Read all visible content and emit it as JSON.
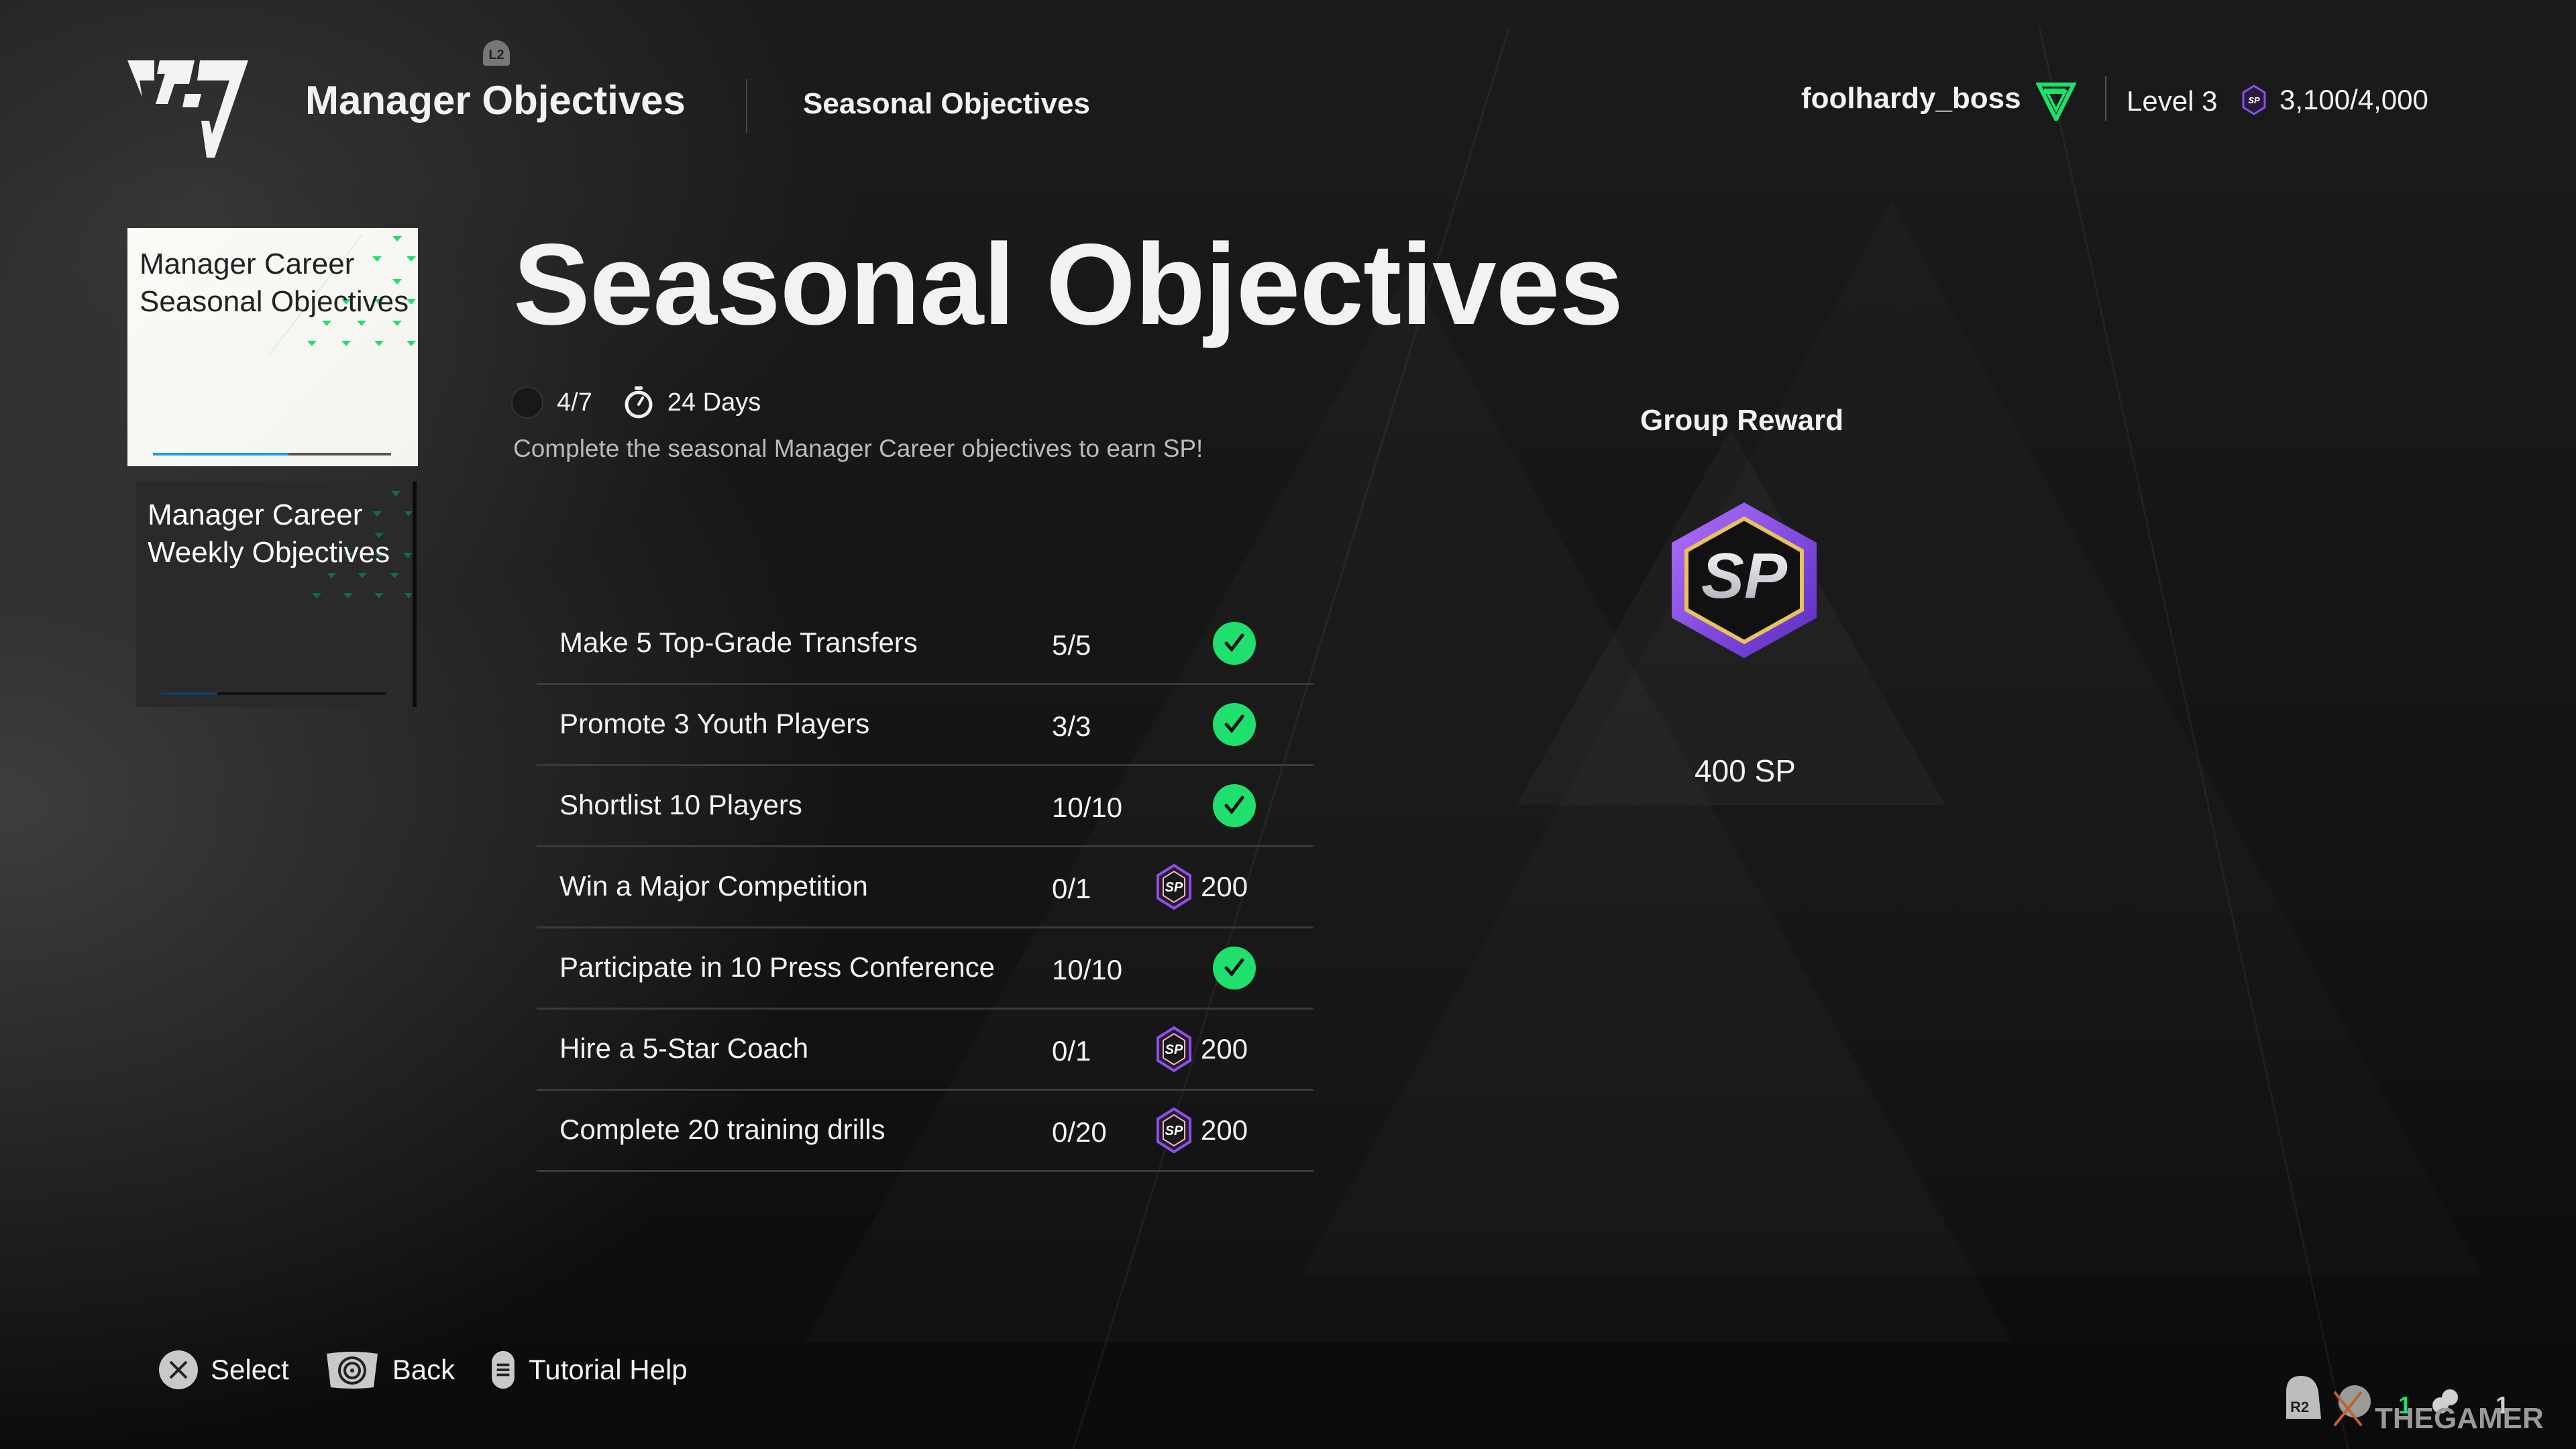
{
  "header": {
    "l2_badge": "L2",
    "title": "Manager Objectives",
    "subtitle": "Seasonal Objectives",
    "username": "foolhardy_boss",
    "level": "Level 3",
    "sp_badge": "SP",
    "sp_total": "3,100/4,000"
  },
  "cards": [
    {
      "title": "Manager Career\nSeasonal Objectives",
      "progress": 0.57,
      "selected": true
    },
    {
      "title": "Manager Career\nWeekly Objectives",
      "progress": 0.25,
      "selected": false
    }
  ],
  "main": {
    "title": "Seasonal Objectives",
    "completed": "4/7",
    "time_left": "24 Days",
    "description": "Complete the seasonal Manager Career objectives to earn SP!",
    "objectives": [
      {
        "name": "Make 5 Top-Grade Transfers",
        "progress": "5/5",
        "status": "complete",
        "reward": ""
      },
      {
        "name": "Promote 3 Youth Players",
        "progress": "3/3",
        "status": "complete",
        "reward": ""
      },
      {
        "name": "Shortlist 10 Players",
        "progress": "10/10",
        "status": "complete",
        "reward": ""
      },
      {
        "name": "Win a Major Competition",
        "progress": "0/1",
        "status": "incomplete",
        "reward": "200"
      },
      {
        "name": "Participate in 10 Press Conference",
        "progress": "10/10",
        "status": "complete",
        "reward": ""
      },
      {
        "name": "Hire a 5-Star Coach",
        "progress": "0/1",
        "status": "incomplete",
        "reward": "200"
      },
      {
        "name": "Complete 20 training drills",
        "progress": "0/20",
        "status": "incomplete",
        "reward": "200"
      }
    ]
  },
  "reward": {
    "label": "Group Reward",
    "badge_text": "SP",
    "amount": "400 SP"
  },
  "footer": {
    "select": "Select",
    "back": "Back",
    "tutorial": "Tutorial Help",
    "r2_badge": "R2",
    "notif_count": "1",
    "friends_count": "1",
    "watermark": "THEGAMER"
  },
  "colors": {
    "accent_green": "#1fe06d",
    "sp_purple": "#7a3fd6",
    "sp_gold": "#e8c25a",
    "progress_blue": "#1e9ce8"
  }
}
